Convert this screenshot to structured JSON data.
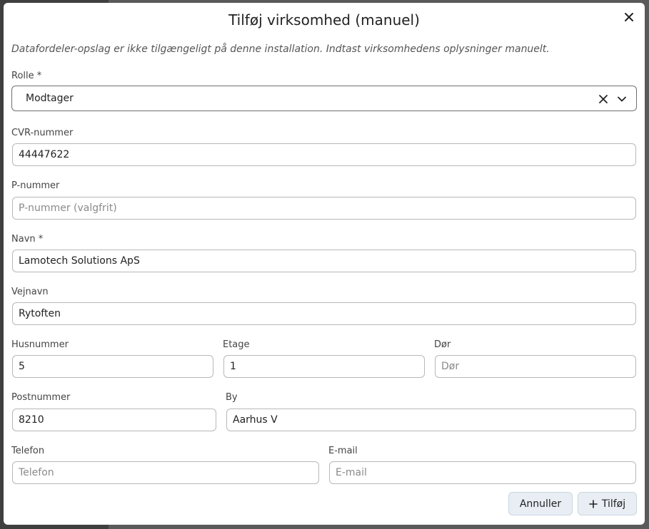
{
  "dialog": {
    "title": "Tilføj virksomhed (manuel)",
    "info": "Datafordeler-opslag er ikke tilgængeligt på denne installation. Indtast virksomhedens oplysninger manuelt."
  },
  "fields": {
    "rolle": {
      "label": "Rolle *",
      "value": "Modtager"
    },
    "cvr": {
      "label": "CVR-nummer",
      "value": "44447622",
      "placeholder": ""
    },
    "pnummer": {
      "label": "P-nummer",
      "value": "",
      "placeholder": "P-nummer (valgfrit)"
    },
    "navn": {
      "label": "Navn *",
      "value": "Lamotech Solutions ApS",
      "placeholder": ""
    },
    "vejnavn": {
      "label": "Vejnavn",
      "value": "Rytoften",
      "placeholder": ""
    },
    "husnummer": {
      "label": "Husnummer",
      "value": "5",
      "placeholder": ""
    },
    "etage": {
      "label": "Etage",
      "value": "1",
      "placeholder": ""
    },
    "dor": {
      "label": "Dør",
      "value": "",
      "placeholder": "Dør"
    },
    "postnummer": {
      "label": "Postnummer",
      "value": "8210",
      "placeholder": ""
    },
    "by": {
      "label": "By",
      "value": "Aarhus V",
      "placeholder": ""
    },
    "telefon": {
      "label": "Telefon",
      "value": "",
      "placeholder": "Telefon"
    },
    "email": {
      "label": "E-mail",
      "value": "",
      "placeholder": "E-mail"
    }
  },
  "buttons": {
    "cancel": "Annuller",
    "add": "Tilføj"
  },
  "icons": {
    "close": "close-icon",
    "clear": "clear-icon",
    "chevron": "chevron-down-icon",
    "plus": "plus-icon"
  }
}
